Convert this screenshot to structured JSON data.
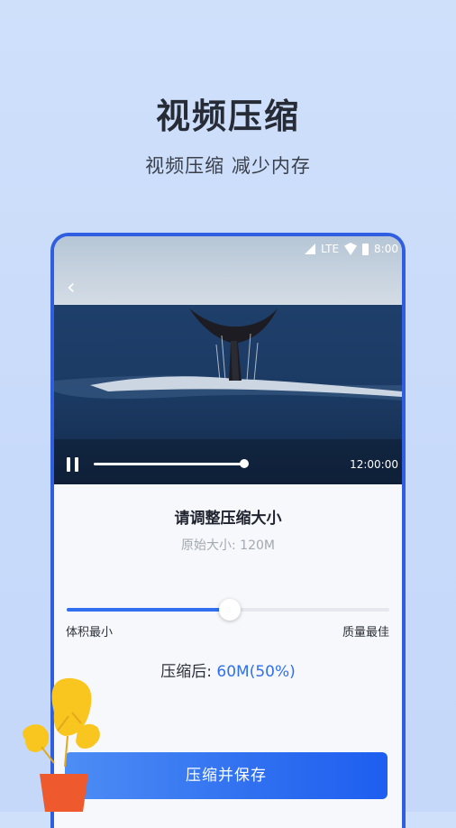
{
  "header": {
    "title": "视频压缩",
    "subtitle": "视频压缩 减少内存"
  },
  "status_bar": {
    "network": "LTE",
    "time": "8:00"
  },
  "player": {
    "time": "12:00:00",
    "progress": 0.55
  },
  "panel": {
    "title": "请调整压缩大小",
    "original_size": "原始大小: 120M",
    "slider_value": 0.5,
    "min_label": "体积最小",
    "max_label": "质量最佳",
    "result_label": "压缩后: ",
    "result_value": "60M(50%)"
  },
  "save_button": "压缩并保存",
  "colors": {
    "accent": "#2f6ff0",
    "frame": "#2f5fe0",
    "background": "#cfe0fb"
  }
}
